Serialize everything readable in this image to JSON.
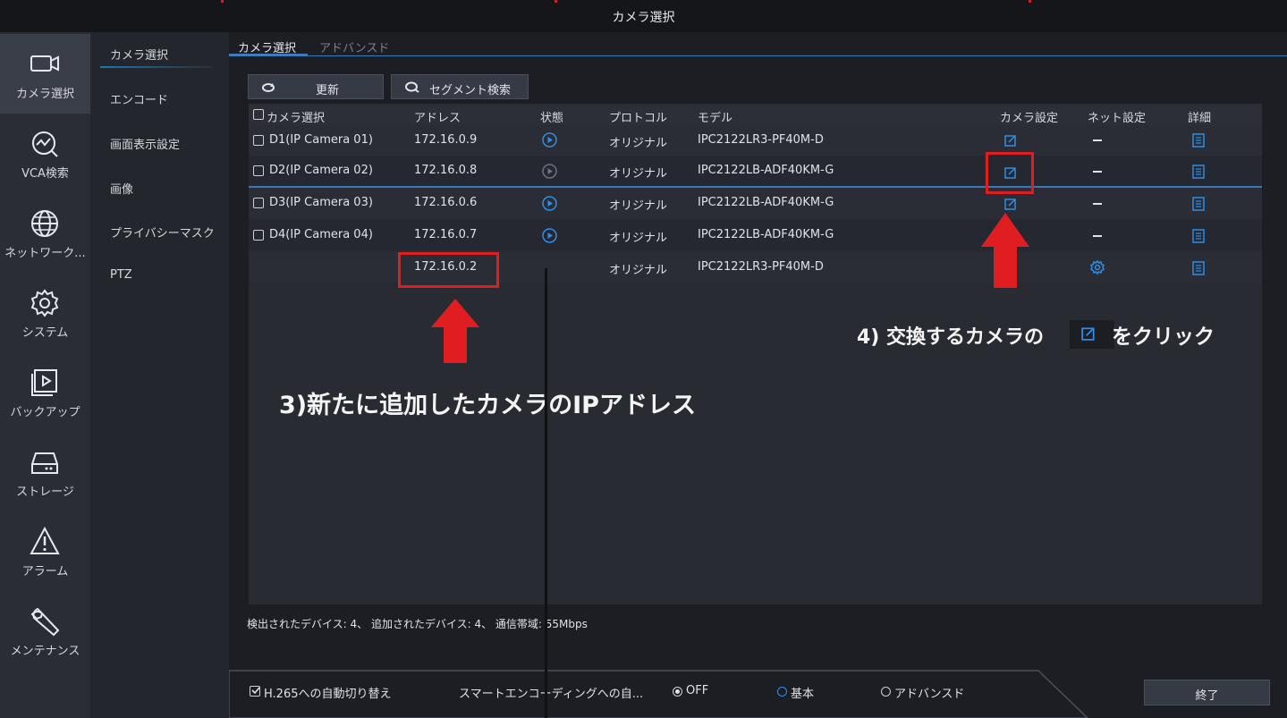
{
  "window": {
    "title": "カメラ選択"
  },
  "sidebar": {
    "items": [
      {
        "label": "カメラ選択",
        "icon": "camera-icon",
        "active": true
      },
      {
        "label": "VCA検索",
        "icon": "vca-search-icon",
        "active": false
      },
      {
        "label": "ネットワーク...",
        "icon": "globe-icon",
        "active": false
      },
      {
        "label": "システム",
        "icon": "gear-icon",
        "active": false
      },
      {
        "label": "バックアップ",
        "icon": "backup-icon",
        "active": false
      },
      {
        "label": "ストレージ",
        "icon": "storage-icon",
        "active": false
      },
      {
        "label": "アラーム",
        "icon": "alarm-icon",
        "active": false
      },
      {
        "label": "メンテナンス",
        "icon": "wrench-icon",
        "active": false
      }
    ]
  },
  "submenu": {
    "items": [
      {
        "label": "カメラ選択",
        "active": true
      },
      {
        "label": "エンコード"
      },
      {
        "label": "画面表示設定"
      },
      {
        "label": "画像"
      },
      {
        "label": "プライバシーマスク"
      },
      {
        "label": "PTZ"
      }
    ]
  },
  "tabs": [
    {
      "label": "カメラ選択",
      "active": true
    },
    {
      "label": "アドバンスド",
      "active": false
    }
  ],
  "toolbar": {
    "refresh_label": "更新",
    "segment_search_label": "セグメント検索"
  },
  "table": {
    "headers": [
      "カメラ選択",
      "アドレス",
      "状態",
      "プロトコル",
      "モデル",
      "カメラ設定",
      "ネット設定",
      "詳細"
    ],
    "rows": [
      {
        "name": "D1(IP Camera 01)",
        "address": "172.16.0.9",
        "status": "online",
        "protocol": "オリジナル",
        "model": "IPC2122LR3-PF40M-D",
        "has_checkbox": true,
        "net": "—"
      },
      {
        "name": "D2(IP Camera 02)",
        "address": "172.16.0.8",
        "status": "offline",
        "protocol": "オリジナル",
        "model": "IPC2122LB-ADF40KM-G",
        "has_checkbox": true,
        "net": "—"
      },
      {
        "name": "D3(IP Camera 03)",
        "address": "172.16.0.6",
        "status": "online",
        "protocol": "オリジナル",
        "model": "IPC2122LB-ADF40KM-G",
        "has_checkbox": true,
        "net": "—"
      },
      {
        "name": "D4(IP Camera 04)",
        "address": "172.16.0.7",
        "status": "online",
        "protocol": "オリジナル",
        "model": "IPC2122LB-ADF40KM-G",
        "has_checkbox": true,
        "net": "—"
      },
      {
        "name": "",
        "address": "172.16.0.2",
        "status": "",
        "protocol": "オリジナル",
        "model": "IPC2122LR3-PF40M-D",
        "has_checkbox": false,
        "net": ""
      }
    ]
  },
  "annotations": {
    "step3": "3)新たに追加したカメラのIPアドレス",
    "step4_prefix": "4) 交換するカメラの",
    "step4_suffix": "をクリック"
  },
  "footer": {
    "status": "検出されたデバイス: 4、 追加されたデバイス: 4、 通信帯域: 55Mbps",
    "h265_label": "H.265への自動切り替え",
    "smart_label": "スマートエンコーディングへの自...",
    "off_label": "OFF",
    "basic_label": "基本",
    "advanced_label": "アドバンスド",
    "exit_label": "終了"
  },
  "colors": {
    "accent": "#3b7cc0",
    "highlight": "#e01d21",
    "icon_blue": "#2f8ee6"
  }
}
